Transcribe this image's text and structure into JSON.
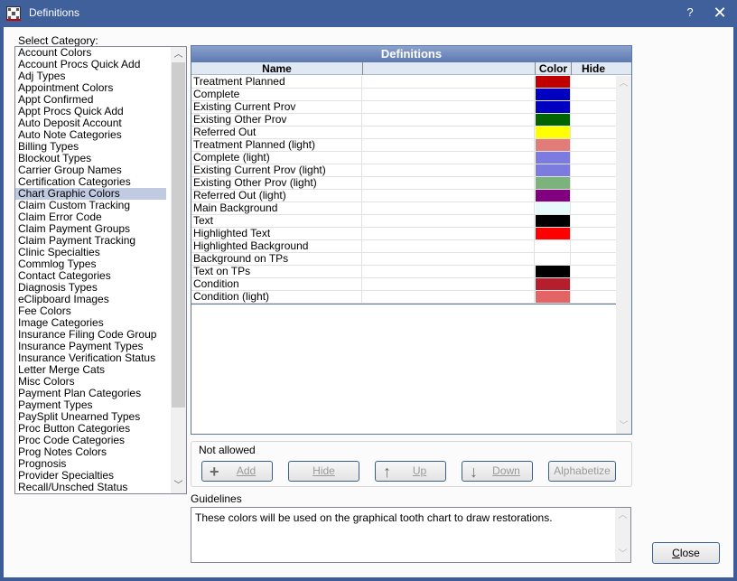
{
  "window": {
    "title": "Definitions",
    "help_label": "?",
    "close_glyph": "✕",
    "app_icon": "grid-app-icon"
  },
  "category": {
    "label": "Select Category:",
    "selected": "Chart Graphic Colors",
    "items": [
      "Account Colors",
      "Account Procs Quick Add",
      "Adj Types",
      "Appointment Colors",
      "Appt Confirmed",
      "Appt Procs Quick Add",
      "Auto Deposit Account",
      "Auto Note Categories",
      "Billing Types",
      "Blockout Types",
      "Carrier Group Names",
      "Certification Categories",
      "Chart Graphic Colors",
      "Claim Custom Tracking",
      "Claim Error Code",
      "Claim Payment Groups",
      "Claim Payment Tracking",
      "Clinic Specialties",
      "Commlog Types",
      "Contact Categories",
      "Diagnosis Types",
      "eClipboard Images",
      "Fee Colors",
      "Image Categories",
      "Insurance Filing Code Group",
      "Insurance Payment Types",
      "Insurance Verification Status",
      "Letter Merge Cats",
      "Misc Colors",
      "Payment Plan Categories",
      "Payment Types",
      "PaySplit Unearned Types",
      "Proc Button Categories",
      "Proc Code Categories",
      "Prog Notes Colors",
      "Prognosis",
      "Provider Specialties",
      "Recall/Unsched Status"
    ]
  },
  "definitions": {
    "title": "Definitions",
    "columns": {
      "name": "Name",
      "blank": "",
      "color": "Color",
      "hide": "Hide"
    },
    "rows": [
      {
        "name": "Treatment Planned",
        "color": "#c00000",
        "hide": ""
      },
      {
        "name": "Complete",
        "color": "#0000c0",
        "hide": ""
      },
      {
        "name": "Existing Current Prov",
        "color": "#0000c0",
        "hide": ""
      },
      {
        "name": "Existing Other Prov",
        "color": "#006400",
        "hide": ""
      },
      {
        "name": "Referred Out",
        "color": "#ffff00",
        "hide": ""
      },
      {
        "name": "Treatment Planned (light)",
        "color": "#e27c78",
        "hide": ""
      },
      {
        "name": "Complete (light)",
        "color": "#7c7ce0",
        "hide": ""
      },
      {
        "name": "Existing Current Prov (light)",
        "color": "#7c7ce0",
        "hide": ""
      },
      {
        "name": "Existing Other Prov (light)",
        "color": "#7cb27c",
        "hide": ""
      },
      {
        "name": "Referred Out (light)",
        "color": "#800080",
        "hide": ""
      },
      {
        "name": "Main Background",
        "color": "#e6fafa",
        "hide": ""
      },
      {
        "name": "Text",
        "color": "#000000",
        "hide": ""
      },
      {
        "name": "Highlighted Text",
        "color": "#ff0000",
        "hide": ""
      },
      {
        "name": "Highlighted Background",
        "color": "#ffffff",
        "hide": ""
      },
      {
        "name": "Background on TPs",
        "color": "#ffffff",
        "hide": ""
      },
      {
        "name": "Text on TPs",
        "color": "#000000",
        "hide": ""
      },
      {
        "name": "Condition",
        "color": "#b41e2d",
        "hide": ""
      },
      {
        "name": "Condition (light)",
        "color": "#e36464",
        "hide": ""
      }
    ]
  },
  "actions": {
    "group_label": "Not allowed",
    "add": "Add",
    "hide": "Hide",
    "up": "Up",
    "down": "Down",
    "alphabetize": "Alphabetize"
  },
  "guidelines": {
    "label": "Guidelines",
    "text": "These colors will be used on the graphical tooth chart to draw restorations."
  },
  "footer": {
    "close_label": "Close"
  }
}
